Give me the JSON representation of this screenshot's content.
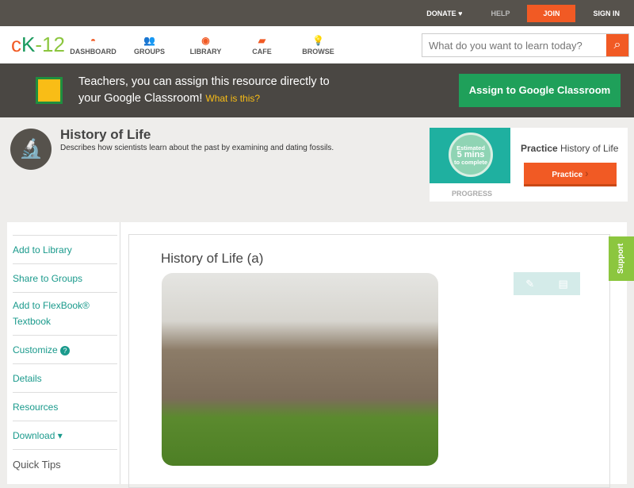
{
  "topbar": {
    "donate": "DONATE ♥",
    "help": "HELP",
    "join": "JOIN",
    "signin": "SIGN IN"
  },
  "nav": {
    "logo": {
      "c": "c",
      "k": "K",
      "n": "-12"
    },
    "items": [
      {
        "label": "DASHBOARD",
        "icon": "◓"
      },
      {
        "label": "GROUPS",
        "icon": "👥"
      },
      {
        "label": "LIBRARY",
        "icon": "◉"
      },
      {
        "label": "CAFE",
        "icon": "▰"
      },
      {
        "label": "BROWSE",
        "icon": "💡"
      }
    ],
    "search_placeholder": "What do you want to learn today?",
    "search_icon": "⌕"
  },
  "banner": {
    "line1": "Teachers, you can assign this resource directly to",
    "line2": "your Google Classroom!",
    "link": "What is this?",
    "button": "Assign to Google Classroom"
  },
  "header": {
    "icon": "🔬",
    "title": "History of Life",
    "description": "Describes how scientists learn about the past by examining and dating fossils."
  },
  "practice": {
    "est1": "Estimated",
    "est2": "5 mins",
    "est3": "to complete",
    "progress": "PROGRESS",
    "title_bold": "Practice",
    "title_rest": " History of Life",
    "button": "Practice",
    "chevron": "›"
  },
  "sidebar": {
    "items": [
      "Add to Library",
      "Share to Groups",
      "Add to FlexBook® Textbook",
      "Customize",
      "Details",
      "Resources",
      "Download ▾"
    ],
    "help_badge": "?",
    "quick_tips": "Quick Tips"
  },
  "content": {
    "title": "History of Life (a)",
    "pencil": "✎",
    "notes": "▤"
  },
  "support": "Support"
}
